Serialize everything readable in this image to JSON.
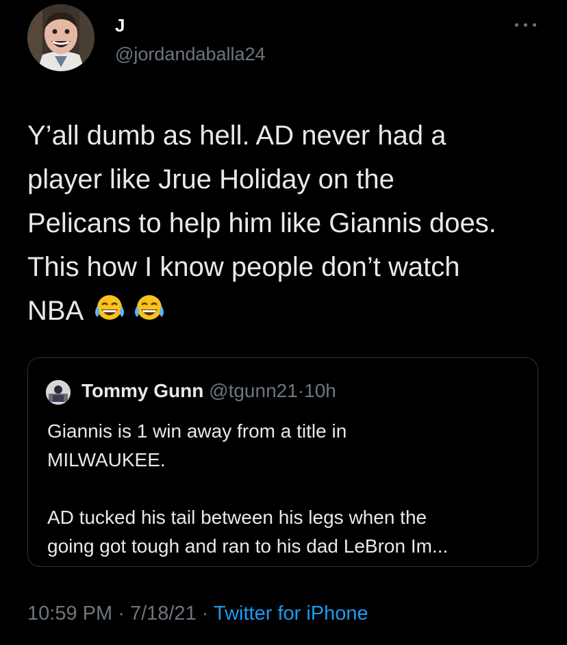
{
  "tweet": {
    "display_name": "J",
    "handle": "@jordandaballa24",
    "more_icon": "ellipsis-icon",
    "text": "Y’all dumb as hell. AD never had a\nplayer like Jrue Holiday on the\nPelicans to help him like Giannis does.\nThis how I know people don’t watch\nNBA",
    "emojis": [
      "😂",
      "😂"
    ],
    "time": "10:59 PM",
    "separator": "·",
    "date": "7/18/21",
    "source": "Twitter for iPhone"
  },
  "quoted_tweet": {
    "name": "Tommy Gunn",
    "handle": "@tgunn21",
    "separator": "·",
    "time": "10h",
    "text": "Giannis is 1 win away from a title in\nMILWAUKEE.\n\nAD tucked his tail between his legs when the\ngoing got tough and ran to his dad LeBron Im..."
  },
  "colors": {
    "background": "#000000",
    "secondary_text": "#6e767d",
    "link": "#1d9bf0",
    "border": "#2f3336"
  }
}
